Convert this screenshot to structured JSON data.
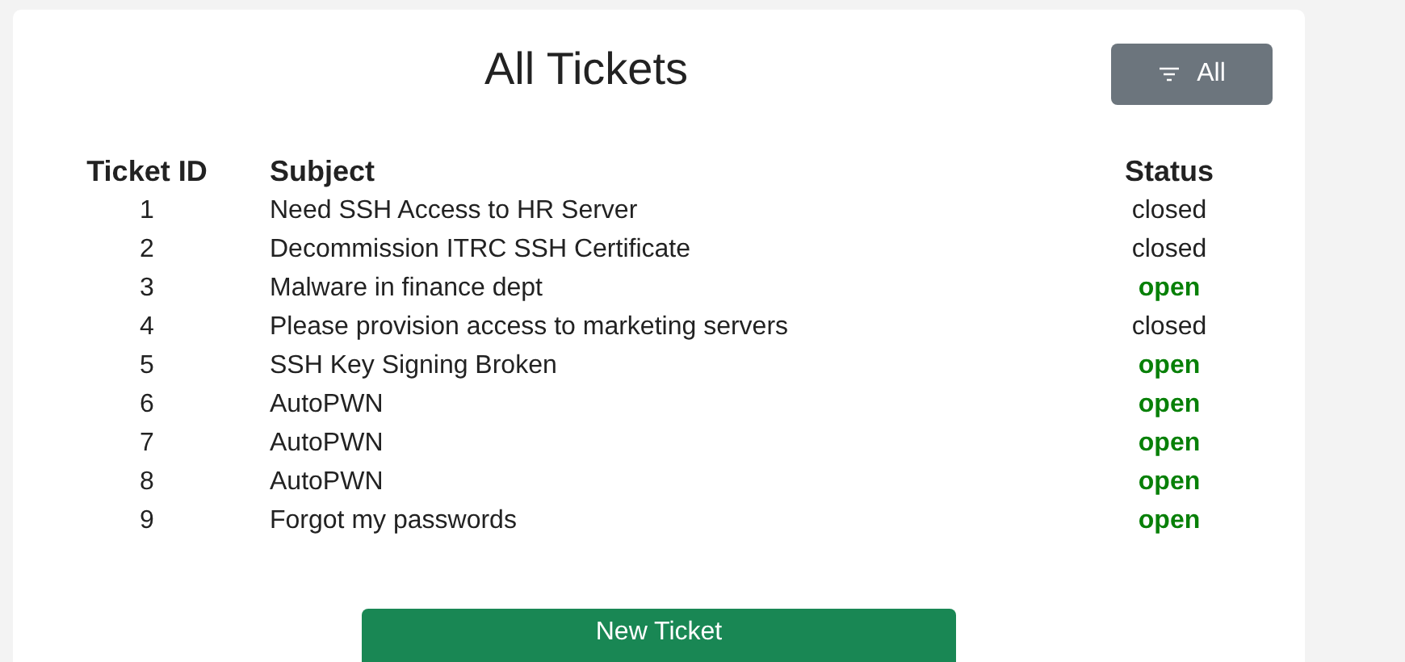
{
  "title": "All Tickets",
  "filter_button": {
    "label": "All"
  },
  "table": {
    "columns": [
      "Ticket ID",
      "Subject",
      "Status"
    ],
    "rows": [
      {
        "id": "1",
        "subject": "Need SSH Access to HR Server",
        "status": "closed",
        "kind": "closed"
      },
      {
        "id": "2",
        "subject": "Decommission ITRC SSH Certificate",
        "status": "closed",
        "kind": "closed"
      },
      {
        "id": "3",
        "subject": "Malware in finance dept",
        "status": "open",
        "kind": "open"
      },
      {
        "id": "4",
        "subject": "Please provision access to marketing servers",
        "status": "closed",
        "kind": "closed"
      },
      {
        "id": "5",
        "subject": "SSH Key Signing Broken",
        "status": "open",
        "kind": "open"
      },
      {
        "id": "6",
        "subject": "AutoPWN",
        "status": "open",
        "kind": "open"
      },
      {
        "id": "7",
        "subject": "AutoPWN",
        "status": "open",
        "kind": "open"
      },
      {
        "id": "8",
        "subject": "AutoPWN",
        "status": "open",
        "kind": "open"
      },
      {
        "id": "9",
        "subject": "Forgot my passwords",
        "status": "open",
        "kind": "open"
      }
    ]
  },
  "new_button": {
    "label": "New Ticket"
  }
}
